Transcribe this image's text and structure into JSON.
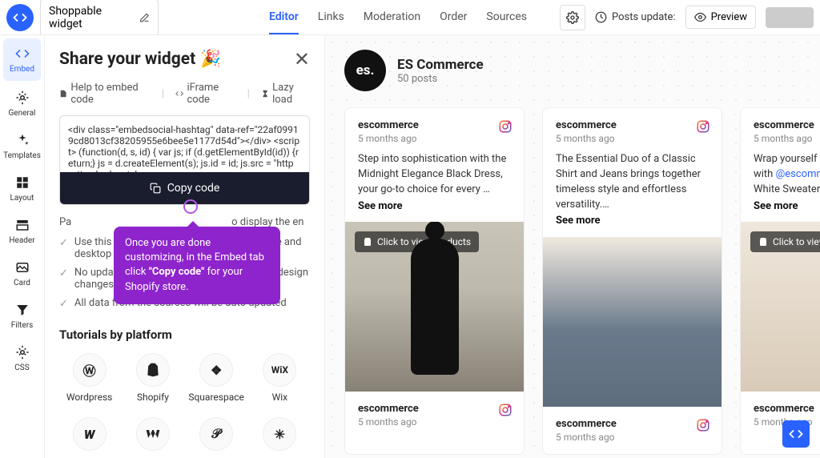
{
  "header": {
    "widget_name": "Shoppable widget",
    "tabs": [
      "Editor",
      "Links",
      "Moderation",
      "Order",
      "Sources"
    ],
    "active_tab": "Editor",
    "posts_update_label": "Posts update:",
    "preview_label": "Preview"
  },
  "sidebar": {
    "items": [
      {
        "label": "Embed",
        "icon": "code-icon"
      },
      {
        "label": "General",
        "icon": "gear-icon"
      },
      {
        "label": "Templates",
        "icon": "sparkle-icon"
      },
      {
        "label": "Layout",
        "icon": "layout-icon"
      },
      {
        "label": "Header",
        "icon": "header-icon"
      },
      {
        "label": "Card",
        "icon": "card-icon"
      },
      {
        "label": "Filters",
        "icon": "filter-icon"
      },
      {
        "label": "CSS",
        "icon": "css-icon"
      }
    ]
  },
  "panel": {
    "title": "Share your widget",
    "title_emoji": "🎉",
    "embed_tabs": {
      "help": "Help to embed code",
      "iframe": "iFrame code",
      "lazy": "Lazy load"
    },
    "code_snippet": "<div class=\"embedsocial-hashtag\" data-ref=\"22af09919cd8013cf38205955e6bee5e1177d54d\"></div> <script> (function(d, s, id) { var js; if (d.getElementById(id)) {return;} js = d.createElement(s); js.id = id; js.src = \"https://embedsocial.",
    "copy_label": "Copy code",
    "paste_label_before": "Pa",
    "paste_label_after": "o display the en",
    "checks": [
      "Use this code on multiple pages, both mobile and desktop",
      "No update of the code needed after making design changes",
      "All data from the sources will be auto updated"
    ],
    "tutorials_heading": "Tutorials by platform",
    "platforms_row1": [
      "Wordpress",
      "Shopify",
      "Squarespace",
      "Wix"
    ]
  },
  "tooltip": {
    "line1": "Once you are done customizing, in the Embed tab click ",
    "bold": "\"Copy code\"",
    "line2": " for your Shopify store."
  },
  "preview": {
    "account_name": "ES Commerce",
    "account_sub": "50 posts",
    "account_logo_text": "es.",
    "overlay_label": "Click to view products",
    "overlay_label_cut": "Click to view pro",
    "see_more": "See more",
    "cards": [
      {
        "user": "escommerce",
        "time": "5 months ago",
        "text": "Step into sophistication with the Midnight Elegance Black Dress, your go-to choice for every …"
      },
      {
        "user": "escommerce",
        "time": "5 months ago",
        "text": "The Essential Duo of a Classic Shirt and Jeans brings together timeless style and effortless versatility.…"
      },
      {
        "user": "escommerce",
        "time": "5 months ago",
        "text_prefix": "Wrap yourself in tin",
        "link": "@escommerc",
        "text_suffix": "White Sweater, the"
      }
    ],
    "bottom_cards": [
      {
        "user": "escommerce",
        "time": "5 months ago"
      },
      {
        "user": "escommerce",
        "time": "5 months ago"
      },
      {
        "user": "escommerce",
        "time": "5 months ago"
      }
    ]
  }
}
